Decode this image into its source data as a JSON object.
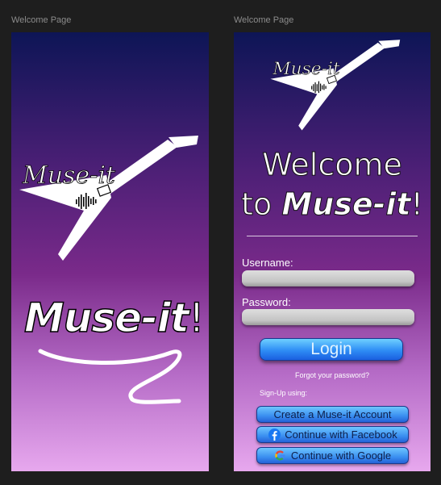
{
  "frames": [
    {
      "label": "Welcome Page"
    },
    {
      "label": "Welcome Page"
    }
  ],
  "logo": {
    "wordmark": "Muse-it",
    "icon": "guitar-icon"
  },
  "splash": {
    "title_brand": "Muse-it",
    "title_suffix": "!"
  },
  "welcome": {
    "line1": "Welcome",
    "line2_prefix": "to ",
    "line2_brand": "Muse-it",
    "line2_suffix": "!"
  },
  "form": {
    "username_label": "Username:",
    "username_value": "",
    "password_label": "Password:",
    "password_value": "",
    "login_label": "Login",
    "forgot_label": "Forgot your password?",
    "signup_label": "Sign-Up using:"
  },
  "signup_options": [
    {
      "label": "Create a Muse-it Account",
      "icon": ""
    },
    {
      "label": "Continue with Facebook",
      "icon": "facebook-icon"
    },
    {
      "label": "Continue with Google",
      "icon": "google-icon"
    }
  ],
  "colors": {
    "background": "#1e1e1e",
    "gradient_top": "#0d1556",
    "gradient_bottom": "#e7a8ee",
    "button_blue": "#2e8df5",
    "facebook_blue": "#1877f2"
  }
}
